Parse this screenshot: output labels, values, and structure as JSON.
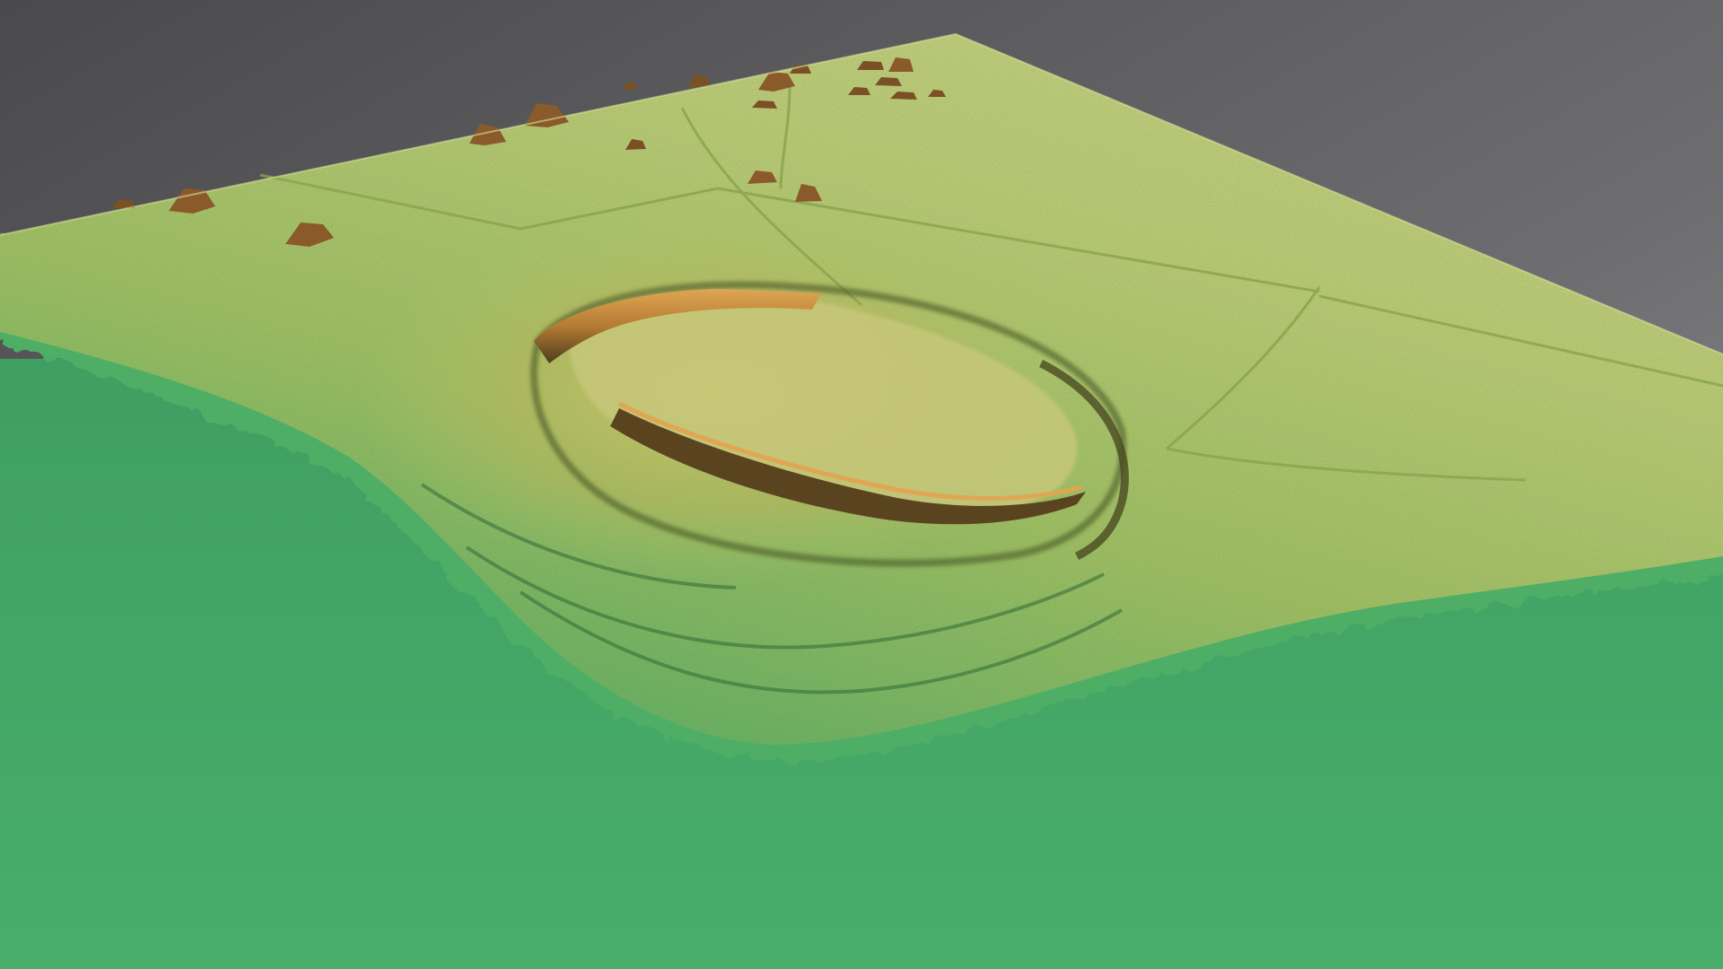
{
  "scene": {
    "colors": {
      "sky_top": "#4b4a4c",
      "sky_bottom": "#8c8b8e",
      "lowland_green": "#45a868",
      "lowland_green_dark": "#3a9a5c",
      "slope_green": "#6cba6a",
      "plateau_yellow_green": "#b8cf6e",
      "plateau_far": "#c9d884",
      "rampart_orange": "#c98b3c",
      "rampart_shadow": "#5a4a22",
      "building_brown": "#8a5a2a"
    },
    "features": {
      "hillfort_rampart": "oval-enclosure",
      "field_boundaries": "linear-banks",
      "buildings": "scattered-structures"
    }
  }
}
